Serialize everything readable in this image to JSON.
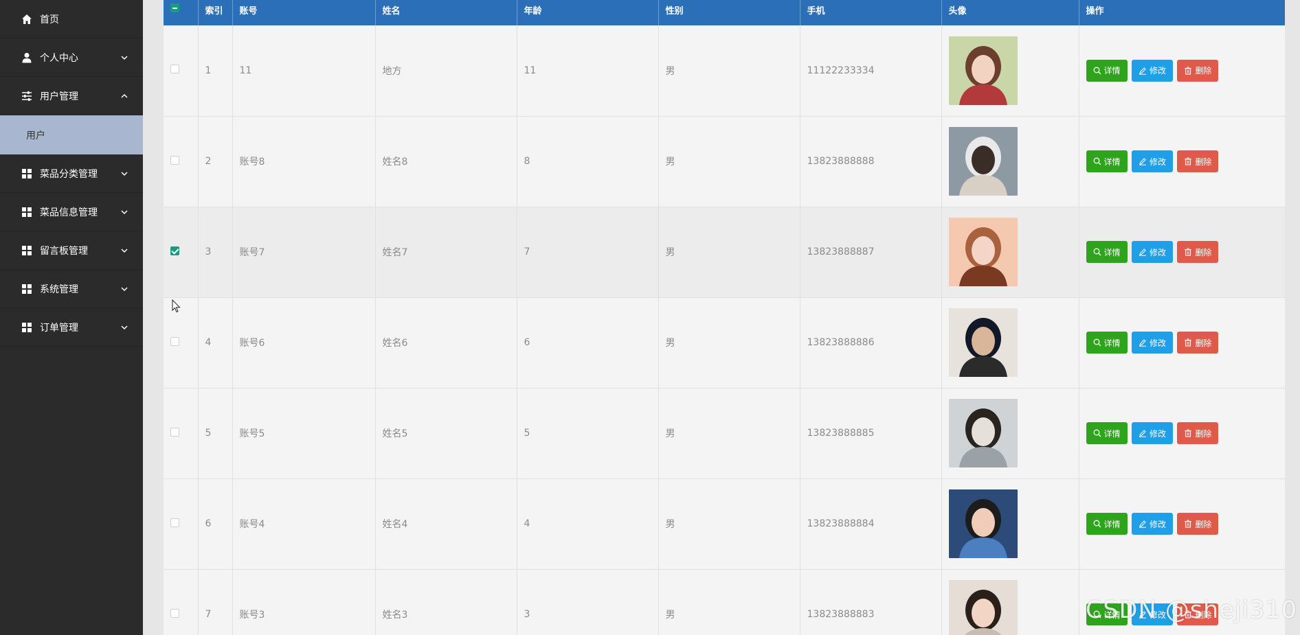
{
  "sidebar": {
    "items": [
      {
        "label": "首页",
        "icon": "home-icon"
      },
      {
        "label": "个人中心",
        "icon": "user-icon",
        "chevron": "down"
      },
      {
        "label": "用户管理",
        "icon": "sliders-icon",
        "chevron": "up"
      },
      {
        "label": "菜品分类管理",
        "icon": "grid-icon",
        "chevron": "down"
      },
      {
        "label": "菜品信息管理",
        "icon": "grid-icon",
        "chevron": "down"
      },
      {
        "label": "留言板管理",
        "icon": "grid-icon",
        "chevron": "down"
      },
      {
        "label": "系统管理",
        "icon": "grid-icon",
        "chevron": "down"
      },
      {
        "label": "订单管理",
        "icon": "grid-icon",
        "chevron": "down"
      }
    ],
    "submenu": {
      "label": "用户"
    }
  },
  "table": {
    "headers": [
      "索引",
      "账号",
      "姓名",
      "年龄",
      "性别",
      "手机",
      "头像",
      "操作"
    ],
    "rows": [
      {
        "index": "1",
        "account": "11",
        "name": "地方",
        "age": "11",
        "gender": "男",
        "phone": "11122233334",
        "checked": false
      },
      {
        "index": "2",
        "account": "账号8",
        "name": "姓名8",
        "age": "8",
        "gender": "男",
        "phone": "13823888888",
        "checked": false
      },
      {
        "index": "3",
        "account": "账号7",
        "name": "姓名7",
        "age": "7",
        "gender": "男",
        "phone": "13823888887",
        "checked": true
      },
      {
        "index": "4",
        "account": "账号6",
        "name": "姓名6",
        "age": "6",
        "gender": "男",
        "phone": "13823888886",
        "checked": false
      },
      {
        "index": "5",
        "account": "账号5",
        "name": "姓名5",
        "age": "5",
        "gender": "男",
        "phone": "13823888885",
        "checked": false
      },
      {
        "index": "6",
        "account": "账号4",
        "name": "姓名4",
        "age": "4",
        "gender": "男",
        "phone": "13823888884",
        "checked": false
      },
      {
        "index": "7",
        "account": "账号3",
        "name": "姓名3",
        "age": "3",
        "gender": "男",
        "phone": "13823888883",
        "checked": false
      }
    ],
    "actions": {
      "detail": "详情",
      "edit": "修改",
      "delete": "删除"
    }
  },
  "watermark": "CSDN @sheji310",
  "colors": {
    "sidebar_bg": "#2b2b2b",
    "submenu_bg": "#a9b6cf",
    "header_bg": "#2a6fb8",
    "detail_btn": "#2ea31c",
    "edit_btn": "#1e9fe8",
    "delete_btn": "#df5a4a",
    "checkbox_checked": "#1a9b80"
  }
}
